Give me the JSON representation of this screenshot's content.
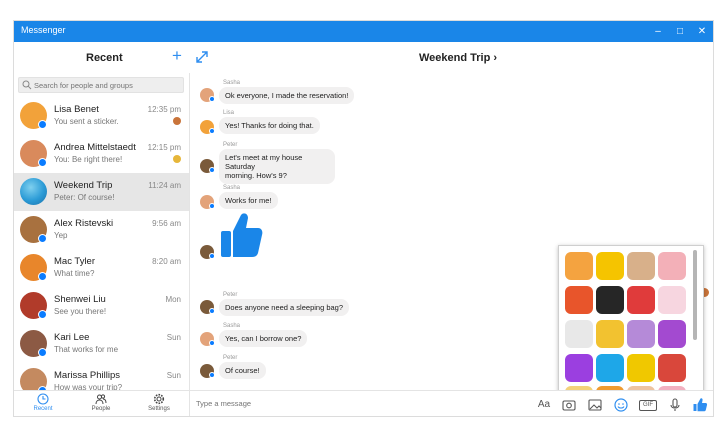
{
  "window": {
    "title": "Messenger",
    "controls": [
      "–",
      "□",
      "✕"
    ]
  },
  "header": {
    "recent_title": "Recent",
    "conversation_title": "Weekend Trip ›"
  },
  "search": {
    "placeholder": "Search for people and groups"
  },
  "conversations": [
    {
      "name": "Lisa Benet",
      "preview": "You sent a sticker.",
      "time": "12:35 pm",
      "color": "#f2a23a"
    },
    {
      "name": "Andrea Mittelstaedt",
      "preview": "You: Be right there!",
      "time": "12:15 pm",
      "color": "#d98a5c"
    },
    {
      "name": "Weekend Trip",
      "preview": "Peter: Of course!",
      "time": "11:24 am",
      "color": "#2b9bd6"
    },
    {
      "name": "Alex Ristevski",
      "preview": "Yep",
      "time": "9:56 am",
      "color": "#a8713f"
    },
    {
      "name": "Mac Tyler",
      "preview": "What time?",
      "time": "8:20 am",
      "color": "#e8862b"
    },
    {
      "name": "Shenwei Liu",
      "preview": "See you there!",
      "time": "Mon",
      "color": "#b13b2a"
    },
    {
      "name": "Kari Lee",
      "preview": "That works for me",
      "time": "Sun",
      "color": "#8c5a44"
    },
    {
      "name": "Marissa Phillips",
      "preview": "How was your trip?",
      "time": "Sun",
      "color": "#c48a60"
    }
  ],
  "nav": {
    "recent": "Recent",
    "people": "People",
    "settings": "Settings"
  },
  "messages": [
    {
      "sender": "Sasha",
      "text": "Ok everyone, I made the reservation!"
    },
    {
      "sender": "Lisa",
      "text": "Yes! Thanks for doing that."
    },
    {
      "sender": "Peter",
      "text_line1": "Let's meet at my house Saturday",
      "text_line2": "morning. How's 9?"
    },
    {
      "sender": "Sasha",
      "text": "Works for me!"
    },
    {
      "sender": "Peter",
      "text": "Does anyone need a sleeping bag?"
    },
    {
      "sender": "Sasha",
      "text": "Yes, can I borrow one?"
    },
    {
      "sender": "Peter",
      "text": "Of course!"
    }
  ],
  "composer": {
    "placeholder": "Type a message",
    "text_tool": "Aa",
    "gif_tool": "GIF"
  },
  "colors": {
    "accent": "#1a86e8",
    "messenger_blue": "#0a7cff",
    "bubble": "#f1f0f0"
  }
}
